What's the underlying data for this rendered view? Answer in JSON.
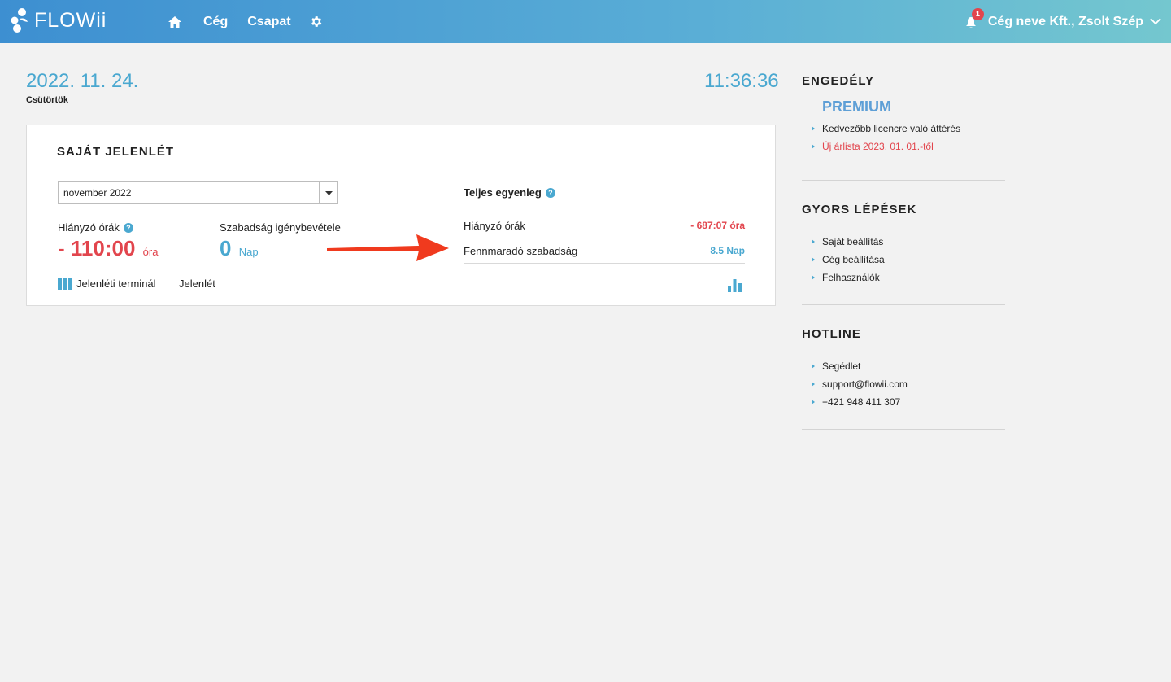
{
  "header": {
    "logo_text": "FLOWii",
    "nav": [
      {
        "icon": "home-icon"
      },
      {
        "label": "Cég"
      },
      {
        "label": "Csapat"
      },
      {
        "icon": "gear-icon"
      }
    ],
    "notification_count": "1",
    "user_label": "Cég neve Kft., Zsolt Szép"
  },
  "date": {
    "value": "2022. 11. 24.",
    "weekday": "Csütörtök",
    "time": "11:36:36"
  },
  "attendance": {
    "title": "SAJÁT JELENLÉT",
    "month_select": "november 2022",
    "missing_hours_label": "Hiányzó órák",
    "missing_hours_value": "- 110:00",
    "missing_hours_unit": "óra",
    "vacation_label": "Szabadság igénybevétele",
    "vacation_value": "0",
    "vacation_unit": "Nap",
    "terminal_link": "Jelenléti terminál",
    "attendance_link": "Jelenlét",
    "balance_title": "Teljes egyenleg",
    "balance_rows": [
      {
        "label": "Hiányzó órák",
        "value": "- 687:07 óra"
      },
      {
        "label": "Fennmaradó szabadság",
        "value": "8.5 Nap"
      }
    ]
  },
  "sidebar": {
    "license": {
      "title": "ENGEDÉLY",
      "plan": "PREMIUM",
      "items": [
        "Kedvezőbb licencre való áttérés",
        "Új árlista 2023. 01. 01.-től"
      ]
    },
    "quick_steps": {
      "title": "GYORS LÉPÉSEK",
      "items": [
        "Saját beállítás",
        "Cég beállítása",
        "Felhasználók"
      ]
    },
    "hotline": {
      "title": "HOTLINE",
      "items": [
        "Segédlet",
        "support@flowii.com",
        "+421 948 411 307"
      ]
    }
  },
  "colors": {
    "accent_blue": "#4aa8d0",
    "alert_red": "#e2454d",
    "premium_blue": "#5e9fd6"
  }
}
